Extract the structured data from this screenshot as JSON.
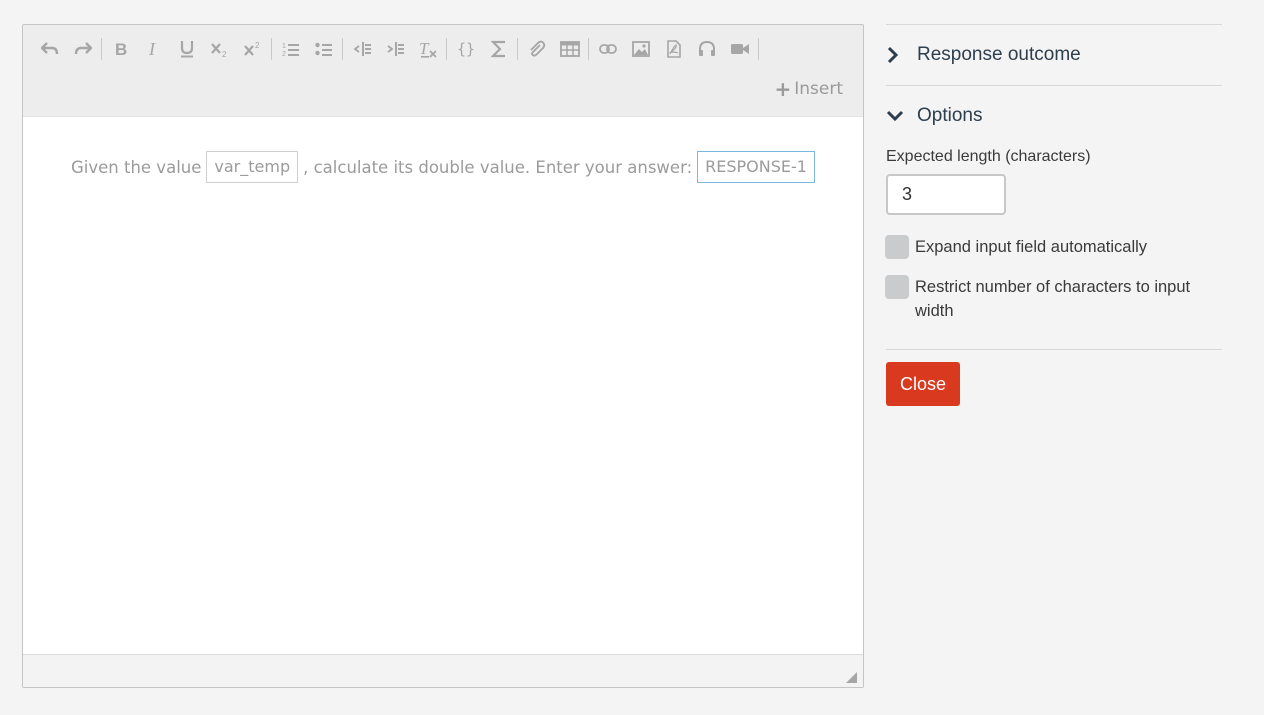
{
  "editor": {
    "toolbar": {
      "buttons": [
        "undo-icon",
        "redo-icon",
        "|",
        "bold-icon",
        "italic-icon",
        "underline-icon",
        "subscript-icon",
        "superscript-icon",
        "|",
        "numbered-list-icon",
        "bullet-list-icon",
        "|",
        "outdent-icon",
        "indent-icon",
        "clear-format-icon",
        "|",
        "braces-icon",
        "sigma-icon",
        "|",
        "attachment-icon",
        "table-icon",
        "|",
        "link-icon",
        "image-icon",
        "pdf-icon",
        "audio-icon",
        "video-icon",
        "|"
      ],
      "insert_label": "Insert"
    },
    "content": {
      "text_before": "Given the value",
      "variable_chip": "var_temp",
      "text_after": ", calculate its double value. Enter your answer:",
      "response_chip": "RESPONSE-1"
    }
  },
  "panel": {
    "response_outcome_label": "Response outcome",
    "options_label": "Options",
    "expected_length_label": "Expected length (characters)",
    "expected_length_value": "3",
    "expand_label": "Expand input field automatically",
    "restrict_label": "Restrict number of characters to input width",
    "close_label": "Close"
  },
  "colors": {
    "close_button": "#d9391e",
    "response_chip_border": "#7cb7dd",
    "heading_text": "#2d3e4e"
  }
}
